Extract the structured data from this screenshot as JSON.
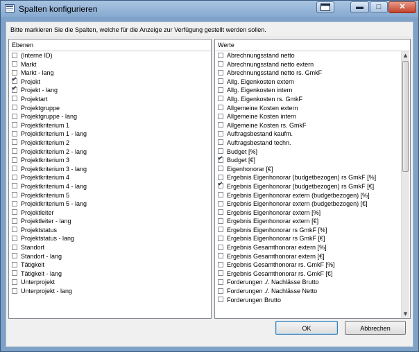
{
  "window": {
    "title": "Spalten konfigurieren",
    "controls": {
      "min": "▬",
      "max": "□",
      "close": "✕"
    }
  },
  "instruction": "Bitte markieren Sie die Spalten, welche für die Anzeige zur Verfügung gestellt werden sollen.",
  "left_panel": {
    "header": "Ebenen",
    "items": [
      {
        "label": "(Interne ID)",
        "checked": false
      },
      {
        "label": "Markt",
        "checked": false
      },
      {
        "label": "Markt - lang",
        "checked": false
      },
      {
        "label": "Projekt",
        "checked": true
      },
      {
        "label": "Projekt - lang",
        "checked": true
      },
      {
        "label": "Projektart",
        "checked": false
      },
      {
        "label": "Projektgruppe",
        "checked": false
      },
      {
        "label": "Projektgruppe - lang",
        "checked": false
      },
      {
        "label": "Projektkriterium 1",
        "checked": false
      },
      {
        "label": "Projektkriterium 1 - lang",
        "checked": false
      },
      {
        "label": "Projektkriterium 2",
        "checked": false
      },
      {
        "label": "Projektkriterium 2 - lang",
        "checked": false
      },
      {
        "label": "Projektkriterium 3",
        "checked": false
      },
      {
        "label": "Projektkriterium 3 - lang",
        "checked": false
      },
      {
        "label": "Projektkriterium 4",
        "checked": false
      },
      {
        "label": "Projektkriterium 4 - lang",
        "checked": false
      },
      {
        "label": "Projektkriterium 5",
        "checked": false
      },
      {
        "label": "Projektkriterium 5 - lang",
        "checked": false
      },
      {
        "label": "Projektleiter",
        "checked": false
      },
      {
        "label": "Projektleiter - lang",
        "checked": false
      },
      {
        "label": "Projektstatus",
        "checked": false
      },
      {
        "label": "Projektstatus - lang",
        "checked": false
      },
      {
        "label": "Standort",
        "checked": false
      },
      {
        "label": "Standort - lang",
        "checked": false
      },
      {
        "label": "Tätigkeit",
        "checked": false
      },
      {
        "label": "Tätigkeit - lang",
        "checked": false
      },
      {
        "label": "Unterprojekt",
        "checked": false
      },
      {
        "label": "Unterprojekt - lang",
        "checked": false
      }
    ]
  },
  "right_panel": {
    "header": "Werte",
    "items": [
      {
        "label": "Abrechnungsstand netto",
        "checked": false
      },
      {
        "label": "Abrechnungsstand netto extern",
        "checked": false
      },
      {
        "label": "Abrechnungsstand netto rs. GmkF",
        "checked": false
      },
      {
        "label": "Allg. Eigenkosten extern",
        "checked": false
      },
      {
        "label": "Allg. Eigenkosten intern",
        "checked": false
      },
      {
        "label": "Allg. Eigenkosten rs. GmkF",
        "checked": false
      },
      {
        "label": "Allgemeine Kosten extern",
        "checked": false
      },
      {
        "label": "Allgemeine Kosten intern",
        "checked": false
      },
      {
        "label": "Allgemeine Kosten rs. GmkF",
        "checked": false
      },
      {
        "label": "Auftragsbestand kaufm.",
        "checked": false
      },
      {
        "label": "Auftragsbestand techn.",
        "checked": false
      },
      {
        "label": "Budget [%]",
        "checked": false
      },
      {
        "label": "Budget [€]",
        "checked": true
      },
      {
        "label": "Eigenhonorar [€]",
        "checked": false
      },
      {
        "label": "Ergebnis Eigenhonorar (budgetbezogen) rs GmkF [%]",
        "checked": false
      },
      {
        "label": "Ergebnis Eigenhonorar (budgetbezogen) rs GmkF [€]",
        "checked": true
      },
      {
        "label": "Ergebnis Eigenhonorar extern (budgetbezogen) [%]",
        "checked": false
      },
      {
        "label": "Ergebnis Eigenhonorar extern (budgetbezogen) [€]",
        "checked": false
      },
      {
        "label": "Ergebnis Eigenhonorar extern [%]",
        "checked": false
      },
      {
        "label": "Ergebnis Eigenhonorar extern [€]",
        "checked": false
      },
      {
        "label": "Ergebnis Eigenhonorar rs GmkF [%]",
        "checked": false
      },
      {
        "label": "Ergebnis Eigenhonorar rs GmkF [€]",
        "checked": false
      },
      {
        "label": "Ergebnis Gesamthonorar extern [%]",
        "checked": false
      },
      {
        "label": "Ergebnis Gesamthonorar extern [€]",
        "checked": false
      },
      {
        "label": "Ergebnis Gesamthonorar rs. GmkF [%]",
        "checked": false
      },
      {
        "label": "Ergebnis Gesamthonorar rs. GmkF [€]",
        "checked": false
      },
      {
        "label": "Forderungen ./. Nachlässe Brutto",
        "checked": false
      },
      {
        "label": "Forderungen ./. Nachlässe Netto",
        "checked": false
      },
      {
        "label": "Forderungen Brutto",
        "checked": false
      }
    ]
  },
  "buttons": {
    "ok": "OK",
    "cancel": "Abbrechen"
  }
}
